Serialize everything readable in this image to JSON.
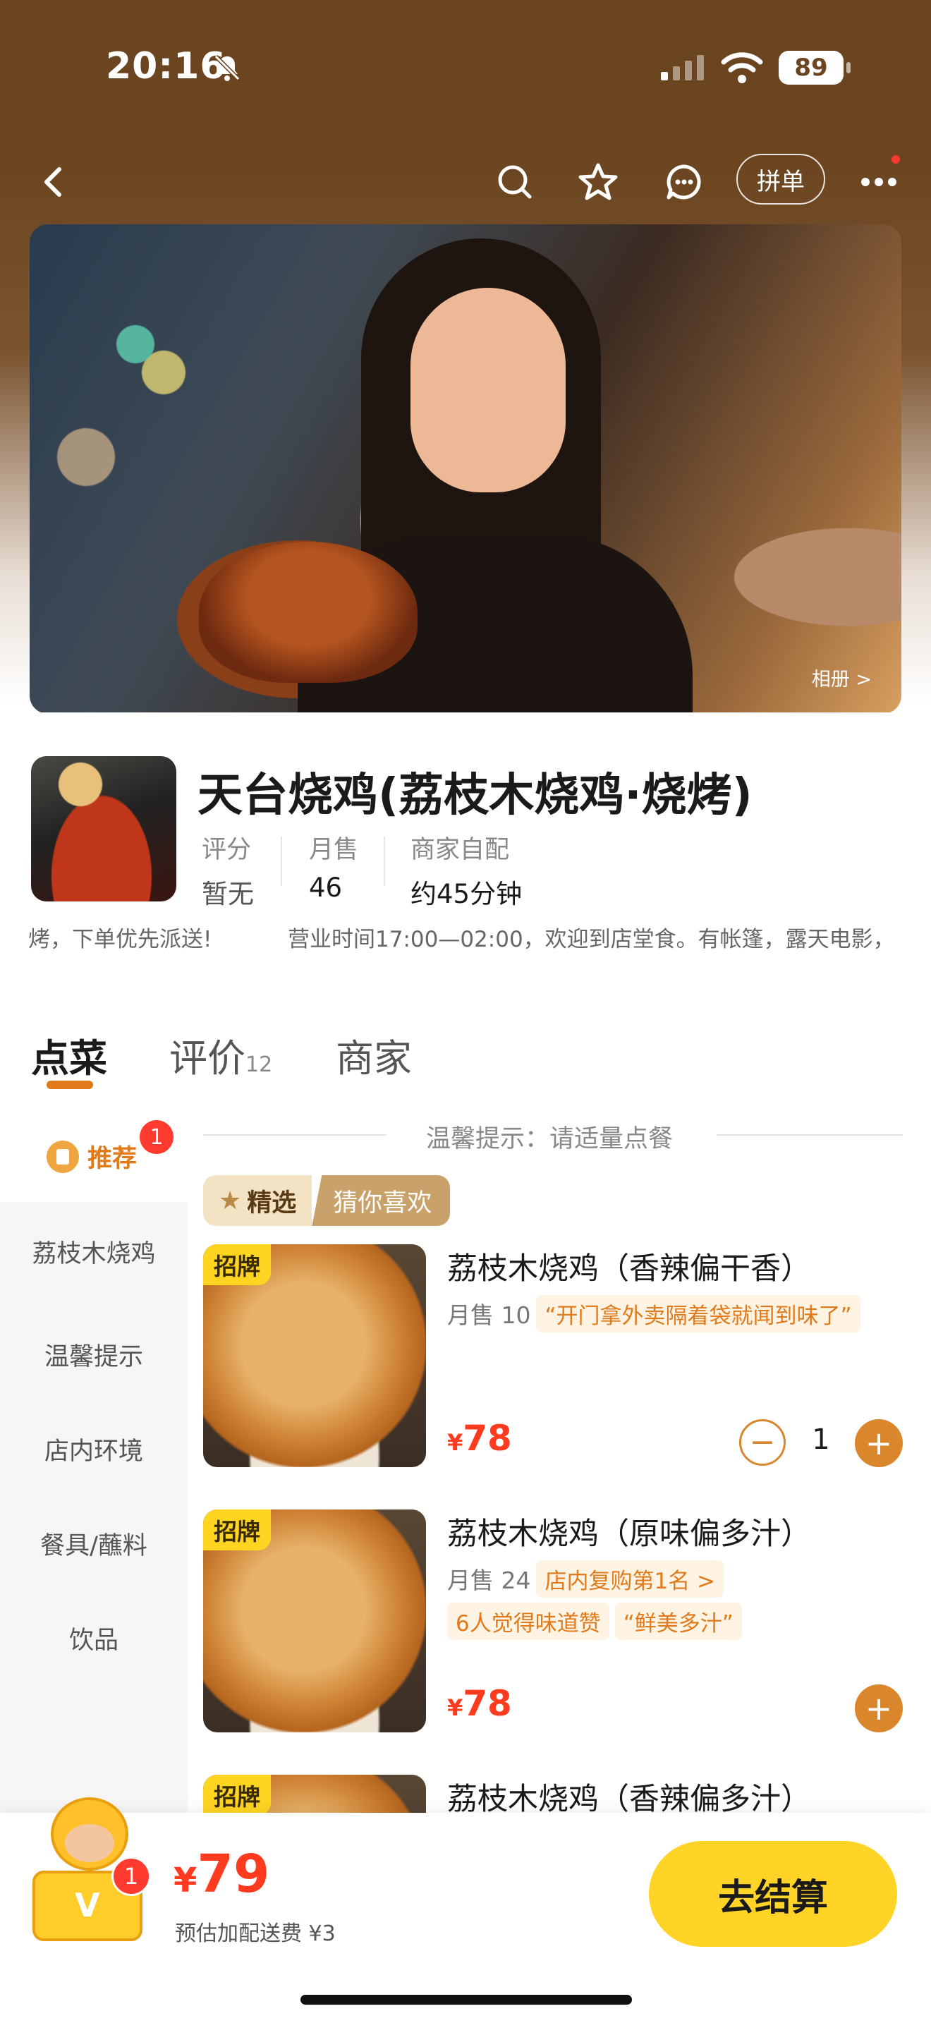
{
  "status_bar": {
    "time": "20:16",
    "battery": "89"
  },
  "nav": {
    "group_order_label": "拼单"
  },
  "banner": {
    "album_link": "相册 >"
  },
  "shop": {
    "name": "天台烧鸡(荔枝木烧鸡·烧烤)",
    "stats": [
      {
        "label": "评分",
        "value": "暂无"
      },
      {
        "label": "月售",
        "value": "46"
      },
      {
        "label": "商家自配",
        "value": "约45分钟"
      }
    ],
    "notice_1": "烤，下单优先派送!",
    "notice_2": "营业时间17:00—02:00，欢迎到店堂食。有帐篷，露天电影，"
  },
  "tabs": [
    {
      "label": "点菜"
    },
    {
      "label": "评价",
      "count": "12"
    },
    {
      "label": "商家"
    }
  ],
  "sidebar": {
    "recommend_label": "推荐",
    "recommend_badge": "1",
    "items": [
      "荔枝木烧鸡",
      "温馨提示",
      "店内环境",
      "餐具/蘸料",
      "饮品"
    ]
  },
  "tip": "温馨提示：请适量点餐",
  "picks": {
    "a": "精选",
    "b": "猜你喜欢"
  },
  "dishes": [
    {
      "tag": "招牌",
      "name": "荔枝木烧鸡（香辣偏干香）",
      "sales": "月售 10",
      "sales_chip": "“开门拿外卖隔着袋就闻到味了”",
      "chips": [],
      "yen": "¥",
      "price": "78",
      "qty": "1"
    },
    {
      "tag": "招牌",
      "name": "荔枝木烧鸡（原味偏多汁）",
      "sales": "月售 24",
      "sales_chip": "店内复购第1名 >",
      "chips": [
        "6人觉得味道赞",
        "“鲜美多汁”"
      ],
      "yen": "¥",
      "price": "78"
    },
    {
      "tag": "招牌",
      "name": "荔枝木烧鸡（香辣偏多汁）"
    }
  ],
  "cart": {
    "badge": "1",
    "yen": "¥",
    "total": "79",
    "fee": "预估加配送费 ¥3",
    "checkout_label": "去结算"
  },
  "colors": {
    "brand_orange": "#e07a1b",
    "price_red": "#ff3b1f",
    "checkout_yellow": "#ffd426",
    "header_brown": "#6b4420"
  }
}
